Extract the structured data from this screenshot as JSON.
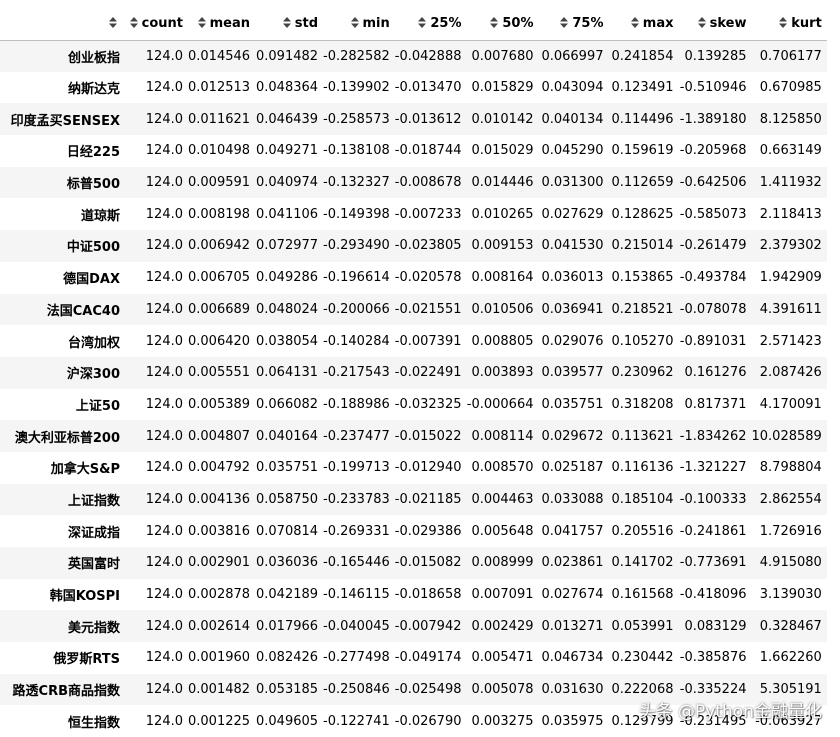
{
  "table": {
    "columns": [
      "count",
      "mean",
      "std",
      "min",
      "25%",
      "50%",
      "75%",
      "max",
      "skew",
      "kurt"
    ],
    "rows": [
      {
        "label": "创业板指",
        "values": [
          "124.0",
          "0.014546",
          "0.091482",
          "-0.282582",
          "-0.042888",
          "0.007680",
          "0.066997",
          "0.241854",
          "0.139285",
          "0.706177"
        ]
      },
      {
        "label": "纳斯达克",
        "values": [
          "124.0",
          "0.012513",
          "0.048364",
          "-0.139902",
          "-0.013470",
          "0.015829",
          "0.043094",
          "0.123491",
          "-0.510946",
          "0.670985"
        ]
      },
      {
        "label": "印度孟买SENSEX",
        "values": [
          "124.0",
          "0.011621",
          "0.046439",
          "-0.258573",
          "-0.013612",
          "0.010142",
          "0.040134",
          "0.114496",
          "-1.389180",
          "8.125850"
        ]
      },
      {
        "label": "日经225",
        "values": [
          "124.0",
          "0.010498",
          "0.049271",
          "-0.138108",
          "-0.018744",
          "0.015029",
          "0.045290",
          "0.159619",
          "-0.205968",
          "0.663149"
        ]
      },
      {
        "label": "标普500",
        "values": [
          "124.0",
          "0.009591",
          "0.040974",
          "-0.132327",
          "-0.008678",
          "0.014446",
          "0.031300",
          "0.112659",
          "-0.642506",
          "1.411932"
        ]
      },
      {
        "label": "道琼斯",
        "values": [
          "124.0",
          "0.008198",
          "0.041106",
          "-0.149398",
          "-0.007233",
          "0.010265",
          "0.027629",
          "0.128625",
          "-0.585073",
          "2.118413"
        ]
      },
      {
        "label": "中证500",
        "values": [
          "124.0",
          "0.006942",
          "0.072977",
          "-0.293490",
          "-0.023805",
          "0.009153",
          "0.041530",
          "0.215014",
          "-0.261479",
          "2.379302"
        ]
      },
      {
        "label": "德国DAX",
        "values": [
          "124.0",
          "0.006705",
          "0.049286",
          "-0.196614",
          "-0.020578",
          "0.008164",
          "0.036013",
          "0.153865",
          "-0.493784",
          "1.942909"
        ]
      },
      {
        "label": "法国CAC40",
        "values": [
          "124.0",
          "0.006689",
          "0.048024",
          "-0.200066",
          "-0.021551",
          "0.010506",
          "0.036941",
          "0.218521",
          "-0.078078",
          "4.391611"
        ]
      },
      {
        "label": "台湾加权",
        "values": [
          "124.0",
          "0.006420",
          "0.038054",
          "-0.140284",
          "-0.007391",
          "0.008805",
          "0.029076",
          "0.105270",
          "-0.891031",
          "2.571423"
        ]
      },
      {
        "label": "沪深300",
        "values": [
          "124.0",
          "0.005551",
          "0.064131",
          "-0.217543",
          "-0.022491",
          "0.003893",
          "0.039577",
          "0.230962",
          "0.161276",
          "2.087426"
        ]
      },
      {
        "label": "上证50",
        "values": [
          "124.0",
          "0.005389",
          "0.066082",
          "-0.188986",
          "-0.032325",
          "-0.000664",
          "0.035751",
          "0.318208",
          "0.817371",
          "4.170091"
        ]
      },
      {
        "label": "澳大利亚标普200",
        "values": [
          "124.0",
          "0.004807",
          "0.040164",
          "-0.237477",
          "-0.015022",
          "0.008114",
          "0.029672",
          "0.113621",
          "-1.834262",
          "10.028589"
        ]
      },
      {
        "label": "加拿大S&P",
        "values": [
          "124.0",
          "0.004792",
          "0.035751",
          "-0.199713",
          "-0.012940",
          "0.008570",
          "0.025187",
          "0.116136",
          "-1.321227",
          "8.798804"
        ]
      },
      {
        "label": "上证指数",
        "values": [
          "124.0",
          "0.004136",
          "0.058750",
          "-0.233783",
          "-0.021185",
          "0.004463",
          "0.033088",
          "0.185104",
          "-0.100333",
          "2.862554"
        ]
      },
      {
        "label": "深证成指",
        "values": [
          "124.0",
          "0.003816",
          "0.070814",
          "-0.269331",
          "-0.029386",
          "0.005648",
          "0.041757",
          "0.205516",
          "-0.241861",
          "1.726916"
        ]
      },
      {
        "label": "英国富时",
        "values": [
          "124.0",
          "0.002901",
          "0.036036",
          "-0.165446",
          "-0.015082",
          "0.008999",
          "0.023861",
          "0.141702",
          "-0.773691",
          "4.915080"
        ]
      },
      {
        "label": "韩国KOSPI",
        "values": [
          "124.0",
          "0.002878",
          "0.042189",
          "-0.146115",
          "-0.018658",
          "0.007091",
          "0.027674",
          "0.161568",
          "-0.418096",
          "3.139030"
        ]
      },
      {
        "label": "美元指数",
        "values": [
          "124.0",
          "0.002614",
          "0.017966",
          "-0.040045",
          "-0.007942",
          "0.002429",
          "0.013271",
          "0.053991",
          "0.083129",
          "0.328467"
        ]
      },
      {
        "label": "俄罗斯RTS",
        "values": [
          "124.0",
          "0.001960",
          "0.082426",
          "-0.277498",
          "-0.049174",
          "0.005471",
          "0.046734",
          "0.230442",
          "-0.385876",
          "1.662260"
        ]
      },
      {
        "label": "路透CRB商品指数",
        "values": [
          "124.0",
          "0.001482",
          "0.053185",
          "-0.250846",
          "-0.025498",
          "0.005078",
          "0.031630",
          "0.222068",
          "-0.335224",
          "5.305191"
        ]
      },
      {
        "label": "恒生指数",
        "values": [
          "124.0",
          "0.001225",
          "0.049605",
          "-0.122741",
          "-0.026790",
          "0.003275",
          "0.035975",
          "0.129799",
          "-0.231495",
          "-0.063927"
        ]
      }
    ]
  },
  "watermark": "头条 @Python金融量化",
  "icons": {
    "sort": "sort-updown-icon"
  }
}
